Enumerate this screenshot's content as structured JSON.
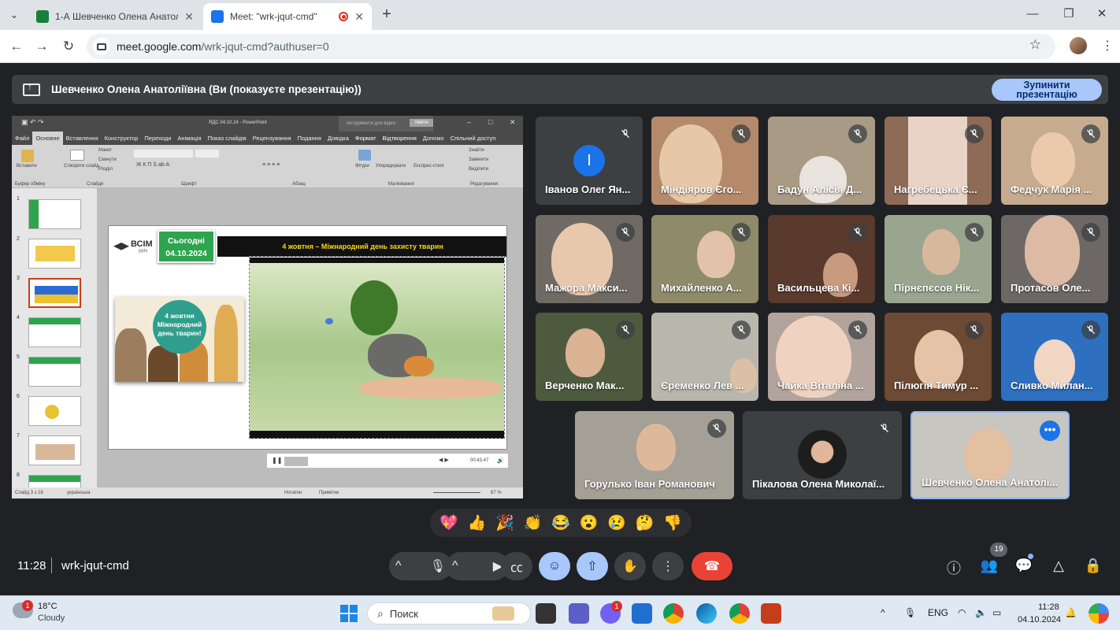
{
  "browser": {
    "tabs": [
      {
        "title": "1-А Шевченко Олена Анатолі",
        "color": "#188038"
      },
      {
        "title": "Meet: \"wrk-jqut-cmd\"",
        "color": "#1a73e8"
      }
    ],
    "url_host": "meet.google.com",
    "url_path": "/wrk-jqut-cmd?authuser=0"
  },
  "banner": {
    "text": "Шевченко Олена Анатоліївна (Ви (показуєте презентацію))",
    "stop_label_1": "Зупинити",
    "stop_label_2": "презентацію"
  },
  "ppt": {
    "title": "ЯДС 04.10.24 - PowerPoint",
    "context_group": "Інструменти для відео",
    "sign_in": "Увійти",
    "tabs": [
      "Файл",
      "Основне",
      "Вставлення",
      "Конструктор",
      "Переходи",
      "Анімація",
      "Показ слайдів",
      "Рецензування",
      "Подання",
      "Довідка",
      "Формат",
      "Відтворення",
      "Допомо",
      "Спільний доступ"
    ],
    "ribbon_groups": [
      "Буфер обміну",
      "Слайди",
      "Шрифт",
      "Абзац",
      "Малювання",
      "Редагування"
    ],
    "ribbon_labels": [
      "Вставити",
      "Створити слайд",
      "Макет",
      "Скинути",
      "Розділ",
      "Фігури",
      "Упорядкувати",
      "Експрес-стилі",
      "Знайти",
      "Замінити",
      "Виділити"
    ],
    "thumb_numbers": [
      "1",
      "2",
      "3",
      "4",
      "5",
      "6",
      "7",
      "8"
    ],
    "slide": {
      "today_label": "Сьогодні",
      "today_date": "04.10.2024",
      "logo_main": "ВСІМ",
      "logo_sub": "pptx",
      "headline": "4 жовтня – Міжнародний день захисту тварин",
      "poster_text": "4 жовтня Міжнародний день тварин!"
    },
    "video_time": "00:43.47",
    "status_left": "Слайд 3 з 18",
    "status_lang": "українська",
    "status_notes": "Нотатки",
    "status_comments": "Примітки",
    "zoom": "67 %"
  },
  "participants": [
    {
      "name": "Іванов Олег Ян...",
      "letter": "І",
      "bg": "#3c4043"
    },
    {
      "name": "Міндіяров Єго...",
      "bg": "#b58a6a"
    },
    {
      "name": "Бадун Алісія Д...",
      "bg": "#a99a86"
    },
    {
      "name": "Нагребецька Є...",
      "bg": "#8d6b56"
    },
    {
      "name": "Федчук Марія ...",
      "bg": "#c7ab8f"
    },
    {
      "name": "Мажора Макси...",
      "bg": "#6f6a64"
    },
    {
      "name": "Михайленко А...",
      "bg": "#8f8b6a"
    },
    {
      "name": "Васильцева Кі...",
      "bg": "#5a3a2c"
    },
    {
      "name": "Пірнєпєсов Нік...",
      "bg": "#9aa590"
    },
    {
      "name": "Протасов Оле...",
      "bg": "#6d6866"
    },
    {
      "name": "Верченко Мак...",
      "bg": "#4d5a3e"
    },
    {
      "name": "Єременко Лев ...",
      "bg": "#b9b6ad"
    },
    {
      "name": "Чайка Віталіна ...",
      "bg": "#b2a49c"
    },
    {
      "name": "Пілюгін Тимур ...",
      "bg": "#6d4a34"
    },
    {
      "name": "Сливко Милан...",
      "bg": "#2f6fbf"
    },
    {
      "name": "Горулько Іван Романович",
      "bg": "#a5a096"
    },
    {
      "name": "Пікалова Олена Миколаї...",
      "bg": "#3c4043"
    },
    {
      "name": "Шевченко Олена Анатолі...",
      "bg": "#c8c6c0"
    }
  ],
  "reactions": [
    "💖",
    "👍",
    "🎉",
    "👏",
    "😂",
    "😮",
    "😢",
    "🤔",
    "👎"
  ],
  "meeting": {
    "time": "11:28",
    "code": "wrk-jqut-cmd",
    "participant_count": "19"
  },
  "taskbar": {
    "temp": "18°C",
    "condition": "Cloudy",
    "weather_badge": "1",
    "search_placeholder": "Поиск",
    "viber_badge": "1",
    "lang": "ENG",
    "time": "11:28",
    "date": "04.10.2024"
  },
  "colors": {
    "accent": "#a8c7fa",
    "end_call": "#ea4335",
    "meet_bg": "#202124"
  }
}
